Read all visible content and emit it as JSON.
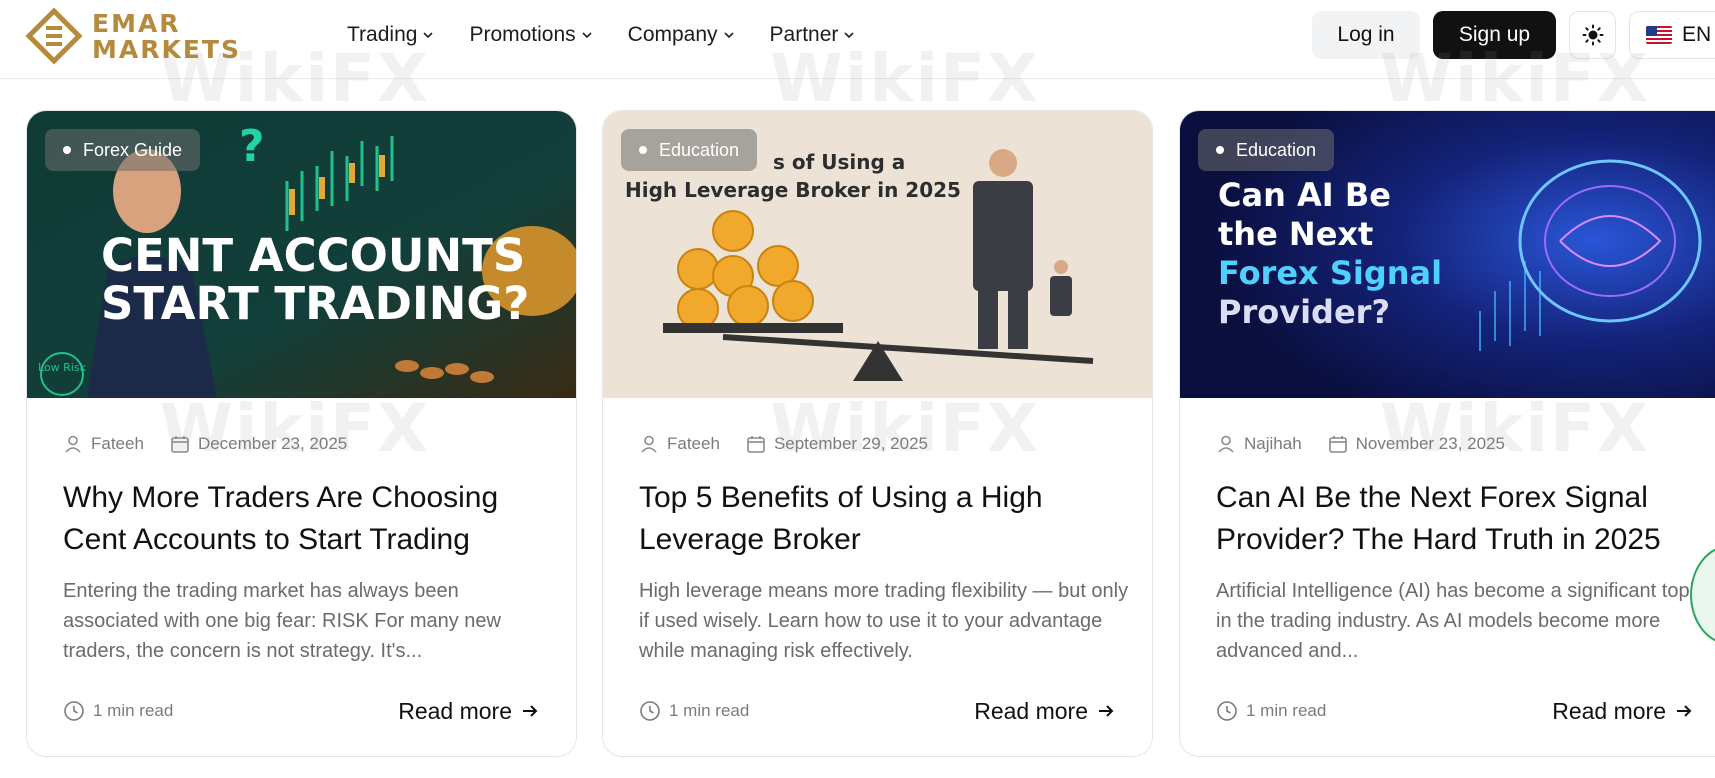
{
  "brand": {
    "line1": "EMAR",
    "line2": "MARKETS",
    "color": "#b58a3c"
  },
  "nav": [
    {
      "label": "Trading"
    },
    {
      "label": "Promotions"
    },
    {
      "label": "Company"
    },
    {
      "label": "Partner"
    }
  ],
  "actions": {
    "login": "Log in",
    "signup": "Sign up",
    "language": "EN",
    "theme_icon": "sun-icon"
  },
  "cards": [
    {
      "tag": "Forex Guide",
      "image_text": {
        "line1": "CENT ACCOUNTS",
        "line2": "START TRADING?",
        "badge": "Low Risk"
      },
      "author": "Fateeh",
      "date": "December 23, 2025",
      "title": "Why More Traders Are Choosing Cent Accounts to Start Trading",
      "excerpt": "Entering the trading market has always been associated with one big fear: RISK For many new traders, the concern is not strategy. It's...",
      "read_time": "1 min read",
      "read_more": "Read more"
    },
    {
      "tag": "Education",
      "image_text": {
        "line1": "s of Using a",
        "line2": "High Leverage Broker in 2025"
      },
      "author": "Fateeh",
      "date": "September 29, 2025",
      "title": "Top 5 Benefits of Using a High Leverage Broker",
      "excerpt": "High leverage means more trading flexibility — but only if used wisely. Learn how to use it to your advantage while managing risk effectively.",
      "read_time": "1 min read",
      "read_more": "Read more"
    },
    {
      "tag": "Education",
      "image_text": {
        "line1": "Can AI Be",
        "line2": "the Next",
        "line3": "Forex Signal",
        "line4": "Provider?"
      },
      "author": "Najihah",
      "date": "November 23, 2025",
      "title": "Can AI Be the Next Forex Signal Provider? The Hard Truth in 2025",
      "excerpt": "Artificial Intelligence (AI) has become a significant topic in the trading industry. As AI models become more advanced and...",
      "read_time": "1 min read",
      "read_more": "Read more"
    }
  ],
  "watermark": "WikiFX"
}
